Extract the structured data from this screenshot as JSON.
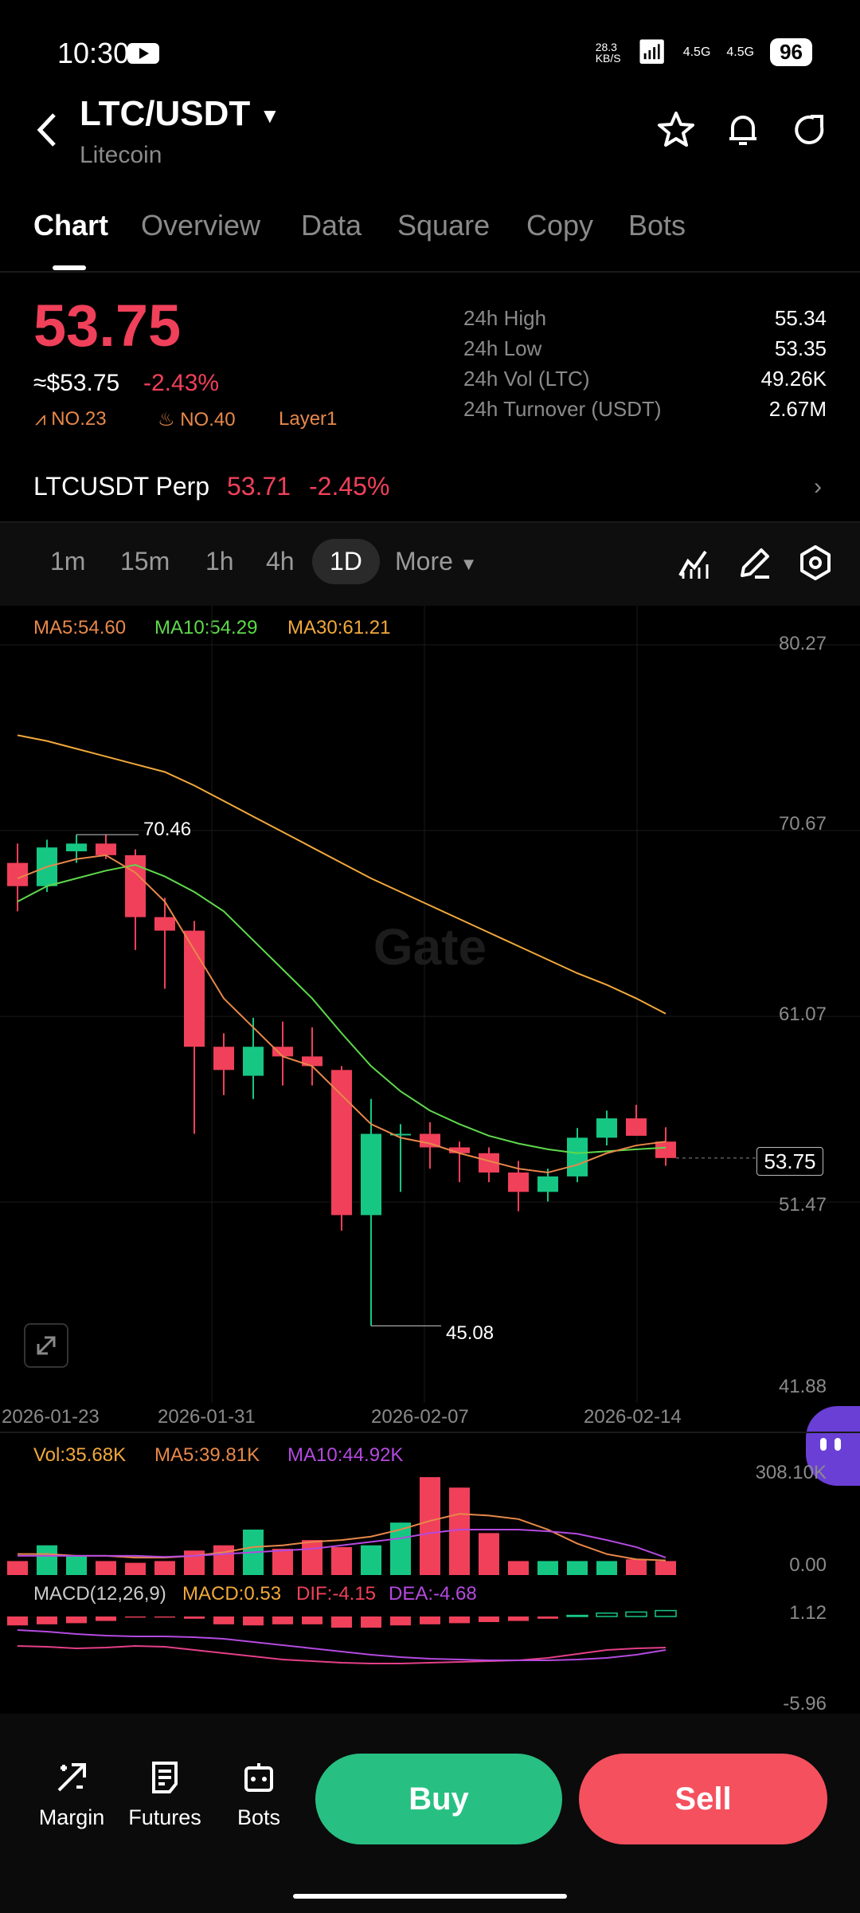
{
  "status_bar": {
    "time": "10:30",
    "net_speed": "28.3\nKB/S",
    "sig1": "4.5G",
    "sig2": "4.5G",
    "battery": "96"
  },
  "header": {
    "pair": "LTC/USDT",
    "name": "Litecoin"
  },
  "tabs": [
    "Chart",
    "Overview",
    "Data",
    "Square",
    "Copy",
    "Bots"
  ],
  "ticker": {
    "price": "53.75",
    "usd_price": "≈$53.75",
    "change": "-2.43%",
    "badges": [
      "NO.23",
      "NO.40",
      "Layer1"
    ],
    "stats": [
      {
        "label": "24h  High",
        "value": "55.34"
      },
      {
        "label": "24h  Low",
        "value": "53.35"
      },
      {
        "label": "24h  Vol (LTC)",
        "value": "49.26K"
      },
      {
        "label": "24h  Turnover (USDT)",
        "value": "2.67M"
      }
    ]
  },
  "perp": {
    "name": "LTCUSDT Perp",
    "price": "53.71",
    "change": "-2.45%"
  },
  "timeframes": [
    "1m",
    "15m",
    "1h",
    "4h",
    "1D",
    "More"
  ],
  "active_timeframe": "1D",
  "chart": {
    "ma5": "MA5:54.60",
    "ma10": "MA10:54.29",
    "ma30": "MA30:61.21",
    "y_labels": [
      "80.27",
      "70.67",
      "61.07",
      "51.47",
      "41.88"
    ],
    "x_labels": [
      "2026-01-23",
      "2026-01-31",
      "2026-02-07",
      "2026-02-14"
    ],
    "current_price": "53.75",
    "high_label": "70.46",
    "low_label": "45.08",
    "watermark": "Gate"
  },
  "volume": {
    "vol": "Vol:35.68K",
    "ma5": "MA5:39.81K",
    "ma10": "MA10:44.92K",
    "y_top": "308.10K",
    "y_bottom": "0.00"
  },
  "macd": {
    "title": "MACD(12,26,9)",
    "macd": "MACD:0.53",
    "dif": "DIF:-4.15",
    "dea": "DEA:-4.68",
    "y_top": "1.12",
    "y_bottom": "-5.96"
  },
  "bottom_nav": [
    "Margin",
    "Futures",
    "Bots"
  ],
  "buttons": {
    "buy": "Buy",
    "sell": "Sell"
  },
  "colors": {
    "up": "#16c784",
    "down": "#f0405a",
    "ma5": "#e8884a",
    "ma10": "#5ed94b",
    "ma30": "#f2a93b",
    "buy": "#27c082",
    "sell": "#f5505e"
  },
  "chart_data": {
    "type": "candlestick",
    "candles": [
      {
        "o": 69.0,
        "h": 70.0,
        "l": 66.5,
        "c": 67.8
      },
      {
        "o": 67.8,
        "h": 70.2,
        "l": 67.5,
        "c": 69.8
      },
      {
        "o": 69.6,
        "h": 70.46,
        "l": 69.0,
        "c": 70.0
      },
      {
        "o": 70.0,
        "h": 70.46,
        "l": 69.2,
        "c": 69.4
      },
      {
        "o": 69.4,
        "h": 69.7,
        "l": 64.5,
        "c": 66.2
      },
      {
        "o": 66.2,
        "h": 67.2,
        "l": 62.5,
        "c": 65.5
      },
      {
        "o": 65.5,
        "h": 66.0,
        "l": 55.0,
        "c": 59.5
      },
      {
        "o": 59.5,
        "h": 60.2,
        "l": 57.0,
        "c": 58.3
      },
      {
        "o": 58.0,
        "h": 61.0,
        "l": 56.8,
        "c": 59.5
      },
      {
        "o": 59.5,
        "h": 60.8,
        "l": 57.5,
        "c": 59.0
      },
      {
        "o": 59.0,
        "h": 60.5,
        "l": 57.5,
        "c": 58.5
      },
      {
        "o": 58.3,
        "h": 58.5,
        "l": 50.0,
        "c": 50.8
      },
      {
        "o": 50.8,
        "h": 56.8,
        "l": 45.08,
        "c": 55.0
      },
      {
        "o": 55.0,
        "h": 55.5,
        "l": 52.0,
        "c": 55.0
      },
      {
        "o": 55.0,
        "h": 55.6,
        "l": 53.2,
        "c": 54.3
      },
      {
        "o": 54.3,
        "h": 54.6,
        "l": 52.5,
        "c": 54.0
      },
      {
        "o": 54.0,
        "h": 54.3,
        "l": 52.5,
        "c": 53.0
      },
      {
        "o": 53.0,
        "h": 53.6,
        "l": 51.0,
        "c": 52.0
      },
      {
        "o": 52.0,
        "h": 53.2,
        "l": 51.5,
        "c": 52.8
      },
      {
        "o": 52.8,
        "h": 55.3,
        "l": 52.5,
        "c": 54.8
      },
      {
        "o": 54.8,
        "h": 56.2,
        "l": 54.4,
        "c": 55.8
      },
      {
        "o": 55.8,
        "h": 56.5,
        "l": 54.9,
        "c": 54.9
      },
      {
        "o": 54.6,
        "h": 55.34,
        "l": 53.35,
        "c": 53.75
      }
    ],
    "ma5": [
      68.2,
      68.8,
      69.2,
      69.4,
      68.5,
      67.0,
      64.5,
      62.0,
      60.5,
      59.0,
      58.5,
      57.0,
      55.5,
      54.8,
      54.5,
      54.0,
      53.6,
      53.2,
      53.0,
      53.4,
      54.0,
      54.4,
      54.6
    ],
    "ma10": [
      67.0,
      67.8,
      68.2,
      68.6,
      68.9,
      68.3,
      67.5,
      66.5,
      65.0,
      63.5,
      62.0,
      60.2,
      58.5,
      57.2,
      56.2,
      55.5,
      54.9,
      54.5,
      54.2,
      54.0,
      54.1,
      54.2,
      54.29
    ],
    "ma30": [
      75.6,
      75.3,
      74.9,
      74.5,
      74.1,
      73.7,
      73.0,
      72.2,
      71.4,
      70.6,
      69.8,
      69.0,
      68.2,
      67.5,
      66.8,
      66.1,
      65.4,
      64.7,
      64.0,
      63.3,
      62.7,
      62.0,
      61.21
    ],
    "ylim": [
      41.88,
      80.27
    ],
    "volume": [
      40,
      85,
      55,
      40,
      35,
      40,
      70,
      85,
      130,
      75,
      100,
      80,
      85,
      150,
      280,
      250,
      120,
      40,
      40,
      40,
      40,
      45,
      40
    ]
  }
}
